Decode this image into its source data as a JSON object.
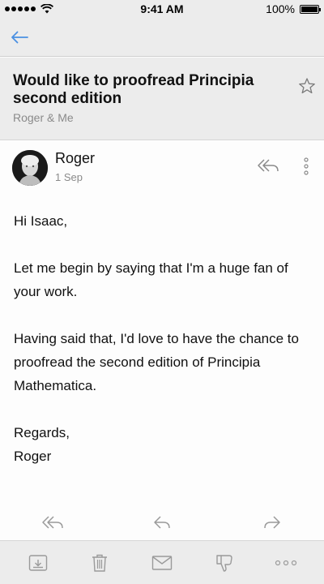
{
  "status_bar": {
    "time": "9:41 AM",
    "battery": "100%",
    "icons": [
      "signal-icon",
      "wifi-icon",
      "battery-icon"
    ]
  },
  "nav": {
    "back_icon": "back-arrow-icon"
  },
  "thread": {
    "subject": "Would like to proofread Principia second edition",
    "participants": "Roger & Me",
    "star_icon": "star-icon"
  },
  "message": {
    "sender": "Roger",
    "date": "1 Sep",
    "body": [
      "Hi Isaac,",
      "Let me begin by saying that I'm a huge fan of your work.",
      "Having said that, I'd love to have the chance to proofread the second edition of Principia Mathematica.",
      "Regards,",
      "Roger"
    ]
  },
  "reply_actions": [
    "reply-all-icon",
    "reply-icon",
    "forward-icon"
  ],
  "toolbar": [
    "archive-icon",
    "trash-icon",
    "mail-icon",
    "thumbs-down-icon",
    "more-icon"
  ],
  "colors": {
    "accent": "#4a90e2",
    "chrome_bg": "#ececec",
    "icon_gray": "#9a9a9a",
    "secondary_text": "#8a8a8a"
  }
}
